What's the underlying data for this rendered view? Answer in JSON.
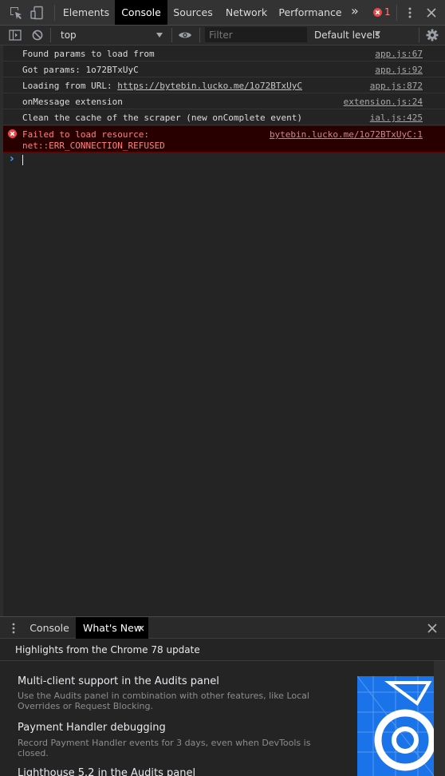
{
  "tabs": [
    {
      "label": "Elements"
    },
    {
      "label": "Console"
    },
    {
      "label": "Sources"
    },
    {
      "label": "Network"
    },
    {
      "label": "Performance"
    }
  ],
  "overflow_label": "»",
  "error_count": "1",
  "toolbar": {
    "context": "top",
    "filter_placeholder": "Filter",
    "levels": "Default levels"
  },
  "messages": [
    {
      "text": "Found params to load from",
      "source": "app.js:67"
    },
    {
      "text": "Got params: 1o72BTxUyC",
      "source": "app.js:92"
    },
    {
      "text": "Loading from URL: ",
      "url": "https://bytebin.lucko.me/1o72BTxUyC",
      "source": "app.js:872"
    },
    {
      "text": "onMessage extension",
      "source": "extension.js:24"
    },
    {
      "text": "Clean the cache of the scraper (new onComplete event)",
      "source": "ial.js:425"
    }
  ],
  "error": {
    "line1": "Failed to load resource:",
    "line2": "net::ERR_CONNECTION_REFUSED",
    "source": "bytebin.lucko.me/1o72BTxUyC:1"
  },
  "prompt": "›",
  "drawer": {
    "tabs": [
      {
        "label": "Console"
      },
      {
        "label": "What's New"
      }
    ],
    "highlights": "Highlights from the Chrome 78 update",
    "items": [
      {
        "title": "Multi-client support in the Audits panel",
        "desc": "Use the Audits panel in combination with other features, like Local Overrides or Request Blocking."
      },
      {
        "title": "Payment Handler debugging",
        "desc": "Record Payment Handler events for 3 days, even when DevTools is closed."
      },
      {
        "title": "Lighthouse 5.2 in the Audits panel"
      }
    ]
  },
  "colors": {
    "accent": "#1a73e8",
    "error": "#ff8080",
    "error_bg": "#290000"
  }
}
